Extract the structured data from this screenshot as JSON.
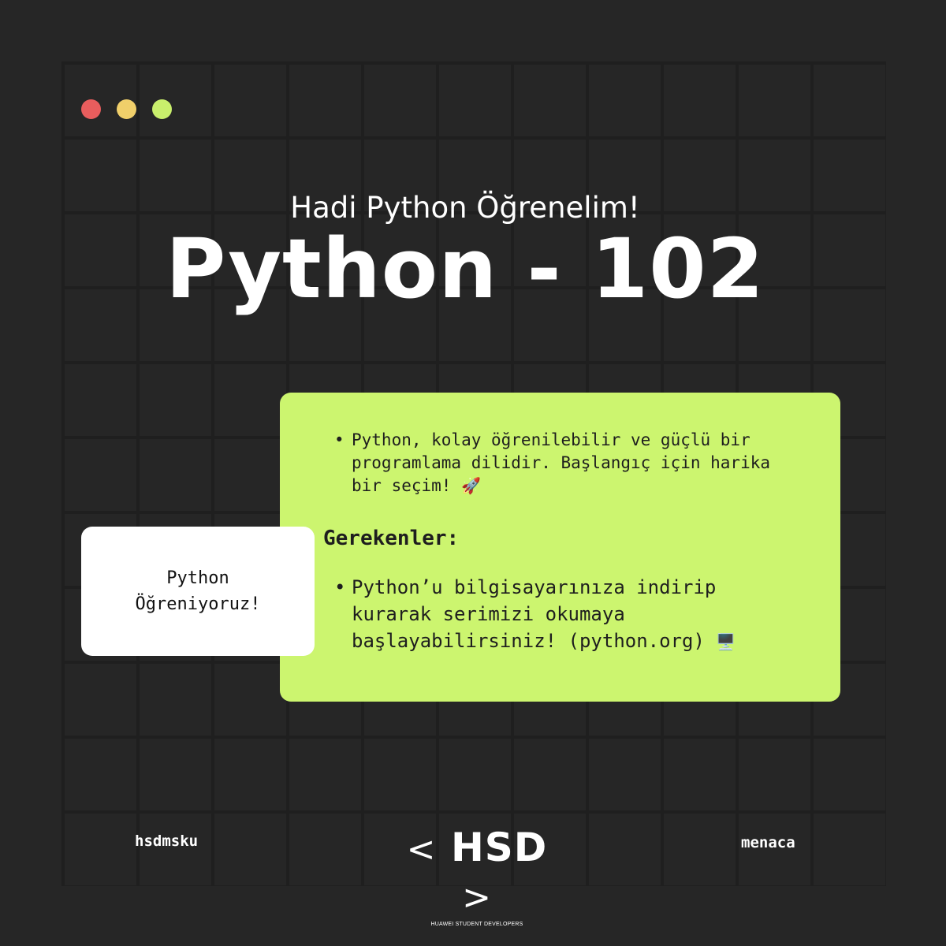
{
  "window_controls": {
    "close_color": "#e85d5d",
    "minimize_color": "#f0cf6a",
    "maximize_color": "#c9ef6c"
  },
  "header": {
    "subtitle": "Hadi Python Öğrenelim!",
    "title": "Python - 102"
  },
  "info_card": {
    "bullet1": "Python, kolay öğrenilebilir ve güçlü bir programlama dilidir. Başlangıç için harika bir seçim!",
    "bullet1_emoji": "🚀",
    "section_title": "Gerekenler:",
    "bullet2": "Python’u bilgisayarınıza indirip kurarak serimizi okumaya başlayabilirsiniz! (python.org)",
    "bullet2_emoji": "🖥️"
  },
  "side_card": {
    "text": "Python Öğreniyoruz!"
  },
  "footer": {
    "left_handle": "hsdmsku",
    "right_handle": "menaca",
    "logo_text": "HSD",
    "logo_left": "<",
    "logo_right": ">",
    "logo_subtitle": "HUAWEI STUDENT DEVELOPERS"
  },
  "colors": {
    "background": "#262626",
    "accent": "#ccf56f"
  }
}
